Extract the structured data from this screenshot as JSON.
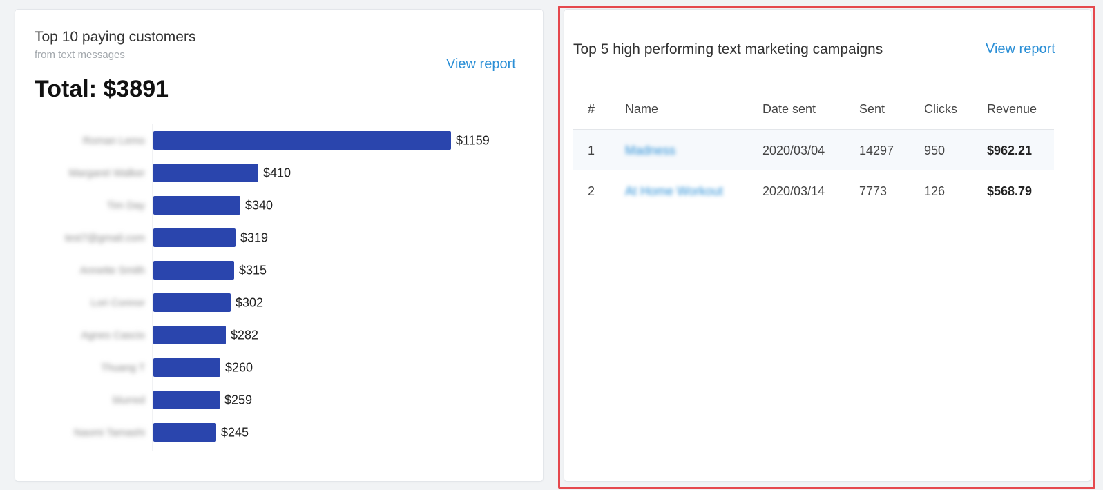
{
  "left_card": {
    "title": "Top 10 paying customers",
    "subtitle": "from text messages",
    "view_report": "View report",
    "total": "Total: $3891"
  },
  "chart_data": {
    "type": "bar",
    "orientation": "horizontal",
    "categories": [
      "Roman Lemo",
      "Margaret Walker",
      "Tim Day",
      "test7@gmail.com",
      "Annette Smith",
      "Lori Connor",
      "Agnes Cascio",
      "Thuang T",
      "blurred",
      "Naomi Tamashi"
    ],
    "values": [
      1159,
      410,
      340,
      319,
      315,
      302,
      282,
      260,
      259,
      245
    ],
    "value_labels": [
      "$1159",
      "$410",
      "$340",
      "$319",
      "$315",
      "$302",
      "$282",
      "$260",
      "$259",
      "$245"
    ],
    "bar_color": "#2a45ad",
    "xlim": [
      0,
      1159
    ],
    "grid": false
  },
  "right_card": {
    "title": "Top 5 high performing text marketing campaigns",
    "view_report": "View report",
    "columns": [
      "#",
      "Name",
      "Date sent",
      "Sent",
      "Clicks",
      "Revenue"
    ],
    "rows": [
      {
        "num": "1",
        "name": "Madness",
        "date": "2020/03/04",
        "sent": "14297",
        "clicks": "950",
        "revenue": "$962.21"
      },
      {
        "num": "2",
        "name": "At Home Workout",
        "date": "2020/03/14",
        "sent": "7773",
        "clicks": "126",
        "revenue": "$568.79"
      }
    ]
  },
  "colors": {
    "accent": "#2b8fd6",
    "highlight": "#e5484d",
    "bar": "#2a45ad"
  }
}
